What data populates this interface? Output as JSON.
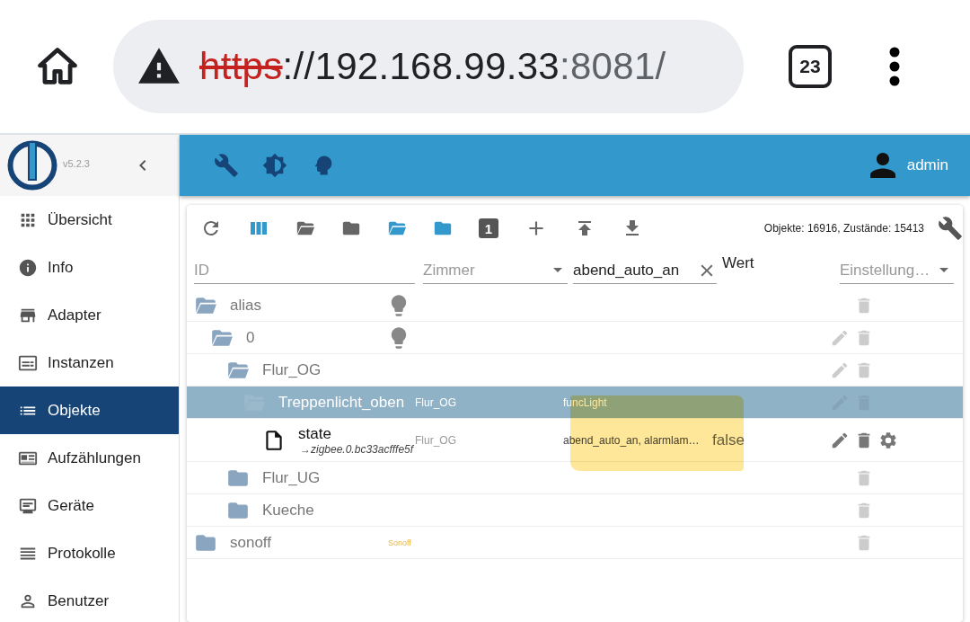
{
  "browser": {
    "url_scheme": "https",
    "url_host": "://192.168.99.33",
    "url_rest": ":8081/",
    "tab_count": "23"
  },
  "sidebar": {
    "version": "v5.2.3",
    "items": [
      {
        "label": "Übersicht",
        "selected": false
      },
      {
        "label": "Info",
        "selected": false
      },
      {
        "label": "Adapter",
        "selected": false
      },
      {
        "label": "Instanzen",
        "selected": false
      },
      {
        "label": "Objekte",
        "selected": true
      },
      {
        "label": "Aufzählungen",
        "selected": false
      },
      {
        "label": "Geräte",
        "selected": false
      },
      {
        "label": "Protokolle",
        "selected": false
      },
      {
        "label": "Benutzer",
        "selected": false
      }
    ]
  },
  "header": {
    "user": "admin"
  },
  "toolbar": {
    "page_button": "1",
    "counts": "Objekte: 16916, Zustände: 15413"
  },
  "filters": {
    "id": {
      "placeholder": "ID"
    },
    "room": {
      "placeholder": "Zimmer"
    },
    "function": {
      "value": "abend_auto_an"
    },
    "value_label": "Wert",
    "settings": {
      "placeholder": "Einstellung…"
    }
  },
  "tree": [
    {
      "name": "alias",
      "kind": "folder",
      "expanded": true,
      "selected": false,
      "bulb": true,
      "edit": false,
      "settings": false,
      "children": [
        {
          "name": "0",
          "kind": "folder",
          "expanded": true,
          "selected": false,
          "bulb": true,
          "edit": true,
          "settings": false,
          "children": [
            {
              "name": "Flur_OG",
              "kind": "folder",
              "expanded": true,
              "selected": false,
              "bulb": false,
              "edit": true,
              "settings": false,
              "children": [
                {
                  "name": "Treppenlicht_oben",
                  "kind": "folder",
                  "expanded": true,
                  "selected": true,
                  "bulb": false,
                  "edit": true,
                  "settings": false,
                  "room": "Flur_OG",
                  "function": "funcLight",
                  "children": [
                    {
                      "name": "state",
                      "kind": "state",
                      "selected": false,
                      "bulb": false,
                      "edit": true,
                      "settings": true,
                      "alias_of": "→zigbee.0.bc33acfffe5f",
                      "room": "Flur_OG",
                      "function": "abend_auto_an, alarmlam…",
                      "value": "false"
                    }
                  ]
                }
              ]
            },
            {
              "name": "Flur_UG",
              "kind": "folder",
              "expanded": false,
              "selected": false,
              "bulb": false,
              "edit": false,
              "settings": false
            },
            {
              "name": "Kueche",
              "kind": "folder",
              "expanded": false,
              "selected": false,
              "bulb": false,
              "edit": false,
              "settings": false
            }
          ]
        }
      ]
    },
    {
      "name": "sonoff",
      "kind": "folder",
      "expanded": false,
      "selected": false,
      "bulb": false,
      "edit": false,
      "settings": false,
      "logo_text": "Sonoff"
    }
  ]
}
